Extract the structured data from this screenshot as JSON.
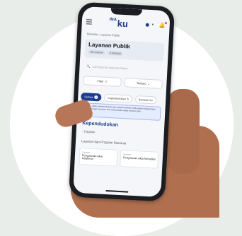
{
  "app": {
    "logo_prefix": "INA",
    "logo_main": "ku"
  },
  "breadcrumb": "Beranda  ›  Layanan Publik",
  "page": {
    "title": "Layanan Publik",
    "chips": [
      "60 Layanan",
      "8 Kategori"
    ]
  },
  "search": {
    "placeholder": "Cari layanan kependudukan"
  },
  "filters": {
    "filter_label": "Filter",
    "sort_label": "Terbaru"
  },
  "tabs": [
    {
      "label": "Semua",
      "count": "8",
      "active": true
    },
    {
      "label": "Kependudukan",
      "count": "5"
    },
    {
      "label": "Bantuan So",
      "count": ""
    }
  ],
  "info": {
    "text": "Untuk mencari layanan atau program tertentu, Anda dapat menggunakan fungsi Pencarian atau cukup kaseni dapat mencari lebih."
  },
  "section": {
    "title": "Kependudukan",
    "badge": "5 layanan",
    "subtitle": "Layanan dan Program Nasional"
  },
  "cards": [
    {
      "category": "Layanan",
      "name": "Pengurusan Akta Kelahiran"
    },
    {
      "category": "Layanan",
      "name": "Pengurusan Akta Kematian"
    }
  ],
  "colors": {
    "brand": "#1d3d8f",
    "background": "#e9ede9"
  }
}
